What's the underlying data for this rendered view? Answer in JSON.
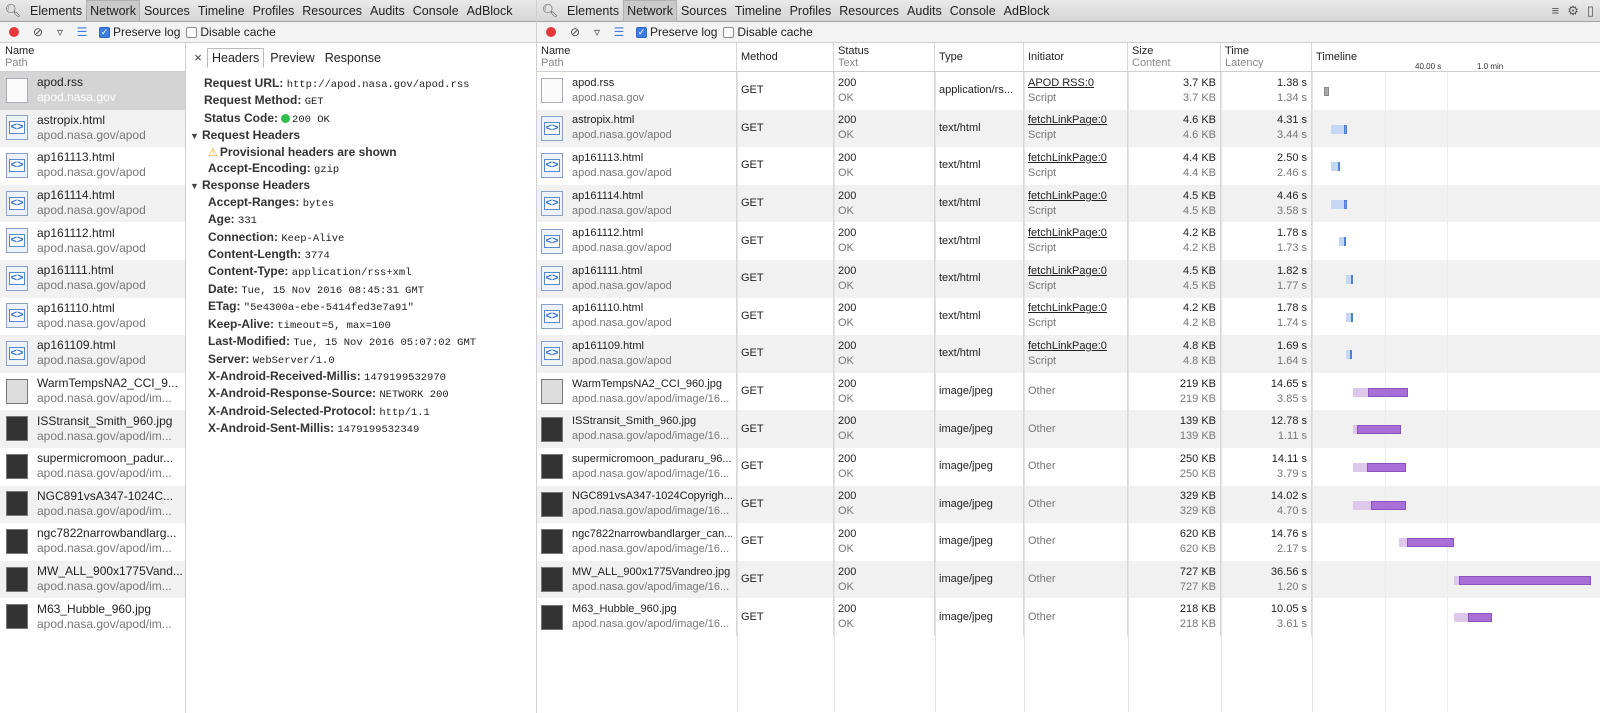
{
  "devtools": {
    "tabs": [
      "Elements",
      "Network",
      "Sources",
      "Timeline",
      "Profiles",
      "Resources",
      "Audits",
      "Console",
      "AdBlock"
    ],
    "selected_tab": "Network",
    "preserve_log": "Preserve log",
    "disable_cache": "Disable cache"
  },
  "left_list": {
    "header_name": "Name",
    "header_path": "Path",
    "items": [
      {
        "name": "apod.rss",
        "path": "apod.nasa.gov",
        "icon": "file-icon"
      },
      {
        "name": "astropix.html",
        "path": "apod.nasa.gov/apod",
        "icon": "html-file-icon"
      },
      {
        "name": "ap161113.html",
        "path": "apod.nasa.gov/apod",
        "icon": "html-file-icon"
      },
      {
        "name": "ap161114.html",
        "path": "apod.nasa.gov/apod",
        "icon": "html-file-icon"
      },
      {
        "name": "ap161112.html",
        "path": "apod.nasa.gov/apod",
        "icon": "html-file-icon"
      },
      {
        "name": "ap161111.html",
        "path": "apod.nasa.gov/apod",
        "icon": "html-file-icon"
      },
      {
        "name": "ap161110.html",
        "path": "apod.nasa.gov/apod",
        "icon": "html-file-icon"
      },
      {
        "name": "ap161109.html",
        "path": "apod.nasa.gov/apod",
        "icon": "html-file-icon"
      },
      {
        "name": "WarmTempsNA2_CCI_9...",
        "path": "apod.nasa.gov/apod/im...",
        "icon": "image-thumbnail-icon"
      },
      {
        "name": "ISStransit_Smith_960.jpg",
        "path": "apod.nasa.gov/apod/im...",
        "icon": "image-thumbnail-icon"
      },
      {
        "name": "supermicromoon_padur...",
        "path": "apod.nasa.gov/apod/im...",
        "icon": "image-thumbnail-icon"
      },
      {
        "name": "NGC891vsA347-1024C...",
        "path": "apod.nasa.gov/apod/im...",
        "icon": "image-thumbnail-icon"
      },
      {
        "name": "ngc7822narrowbandlarg...",
        "path": "apod.nasa.gov/apod/im...",
        "icon": "image-thumbnail-icon"
      },
      {
        "name": "MW_ALL_900x1775Vand...",
        "path": "apod.nasa.gov/apod/im...",
        "icon": "image-thumbnail-icon"
      },
      {
        "name": "M63_Hubble_960.jpg",
        "path": "apod.nasa.gov/apod/im...",
        "icon": "image-thumbnail-icon"
      }
    ]
  },
  "headers_panel": {
    "tabs": [
      "Headers",
      "Preview",
      "Response"
    ],
    "general": [
      {
        "k": "Request URL:",
        "v": "http://apod.nasa.gov/apod.rss"
      },
      {
        "k": "Request Method:",
        "v": "GET"
      }
    ],
    "status_code_label": "Status Code:",
    "status_code_value": "200 OK",
    "request_headers_title": "Request Headers",
    "provisional_notice": "Provisional headers are shown",
    "request_headers": [
      {
        "k": "Accept-Encoding:",
        "v": "gzip"
      }
    ],
    "response_headers_title": "Response Headers",
    "response_headers": [
      {
        "k": "Accept-Ranges:",
        "v": "bytes"
      },
      {
        "k": "Age:",
        "v": "331"
      },
      {
        "k": "Connection:",
        "v": "Keep-Alive"
      },
      {
        "k": "Content-Length:",
        "v": "3774"
      },
      {
        "k": "Content-Type:",
        "v": "application/rss+xml"
      },
      {
        "k": "Date:",
        "v": "Tue, 15 Nov 2016 08:45:31 GMT"
      },
      {
        "k": "ETag:",
        "v": "\"5e4300a-ebe-5414fed3e7a91\""
      },
      {
        "k": "Keep-Alive:",
        "v": "timeout=5, max=100"
      },
      {
        "k": "Last-Modified:",
        "v": "Tue, 15 Nov 2016 05:07:02 GMT"
      },
      {
        "k": "Server:",
        "v": "WebServer/1.0"
      },
      {
        "k": "X-Android-Received-Millis:",
        "v": "1479199532970"
      },
      {
        "k": "X-Android-Response-Source:",
        "v": "NETWORK 200"
      },
      {
        "k": "X-Android-Selected-Protocol:",
        "v": "http/1.1"
      },
      {
        "k": "X-Android-Sent-Millis:",
        "v": "1479199532349"
      }
    ]
  },
  "grid": {
    "columns": {
      "name": "Name",
      "path": "Path",
      "method": "Method",
      "status": "Status",
      "text": "Text",
      "type": "Type",
      "initiator": "Initiator",
      "size": "Size",
      "content": "Content",
      "time": "Time",
      "latency": "Latency",
      "timeline": "Timeline"
    },
    "timeline_marks": [
      "40.00 s",
      "1.0 min"
    ],
    "rows": [
      {
        "name": "apod.rss",
        "path": "apod.nasa.gov",
        "method": "GET",
        "status": "200",
        "text": "OK",
        "type": "application/rs...",
        "init": "APOD RSS:0",
        "init2": "Script",
        "size": "3.7 KB",
        "content": "3.7 KB",
        "time": "1.38 s",
        "latency": "1.34 s",
        "kind": "rss",
        "start": 0.5,
        "wait": 1.34,
        "total": 1.38
      },
      {
        "name": "astropix.html",
        "path": "apod.nasa.gov/apod",
        "method": "GET",
        "status": "200",
        "text": "OK",
        "type": "text/html",
        "init": "fetchLinkPage:0",
        "init2": "Script",
        "size": "4.6 KB",
        "content": "4.6 KB",
        "time": "4.31 s",
        "latency": "3.44 s",
        "kind": "doc",
        "start": 2.3,
        "wait": 3.44,
        "total": 4.31
      },
      {
        "name": "ap161113.html",
        "path": "apod.nasa.gov/apod",
        "method": "GET",
        "status": "200",
        "text": "OK",
        "type": "text/html",
        "init": "fetchLinkPage:0",
        "init2": "Script",
        "size": "4.4 KB",
        "content": "4.4 KB",
        "time": "2.50 s",
        "latency": "2.46 s",
        "kind": "doc",
        "start": 2.3,
        "wait": 2.46,
        "total": 2.5
      },
      {
        "name": "ap161114.html",
        "path": "apod.nasa.gov/apod",
        "method": "GET",
        "status": "200",
        "text": "OK",
        "type": "text/html",
        "init": "fetchLinkPage:0",
        "init2": "Script",
        "size": "4.5 KB",
        "content": "4.5 KB",
        "time": "4.46 s",
        "latency": "3.58 s",
        "kind": "doc",
        "start": 2.3,
        "wait": 3.58,
        "total": 4.46
      },
      {
        "name": "ap161112.html",
        "path": "apod.nasa.gov/apod",
        "method": "GET",
        "status": "200",
        "text": "OK",
        "type": "text/html",
        "init": "fetchLinkPage:0",
        "init2": "Script",
        "size": "4.2 KB",
        "content": "4.2 KB",
        "time": "1.78 s",
        "latency": "1.73 s",
        "kind": "doc",
        "start": 4.6,
        "wait": 1.73,
        "total": 1.78
      },
      {
        "name": "ap161111.html",
        "path": "apod.nasa.gov/apod",
        "method": "GET",
        "status": "200",
        "text": "OK",
        "type": "text/html",
        "init": "fetchLinkPage:0",
        "init2": "Script",
        "size": "4.5 KB",
        "content": "4.5 KB",
        "time": "1.82 s",
        "latency": "1.77 s",
        "kind": "doc",
        "start": 6.4,
        "wait": 1.77,
        "total": 1.82
      },
      {
        "name": "ap161110.html",
        "path": "apod.nasa.gov/apod",
        "method": "GET",
        "status": "200",
        "text": "OK",
        "type": "text/html",
        "init": "fetchLinkPage:0",
        "init2": "Script",
        "size": "4.2 KB",
        "content": "4.2 KB",
        "time": "1.78 s",
        "latency": "1.74 s",
        "kind": "doc",
        "start": 6.4,
        "wait": 1.74,
        "total": 1.78
      },
      {
        "name": "ap161109.html",
        "path": "apod.nasa.gov/apod",
        "method": "GET",
        "status": "200",
        "text": "OK",
        "type": "text/html",
        "init": "fetchLinkPage:0",
        "init2": "Script",
        "size": "4.8 KB",
        "content": "4.8 KB",
        "time": "1.69 s",
        "latency": "1.64 s",
        "kind": "doc",
        "start": 6.4,
        "wait": 1.64,
        "total": 1.69
      },
      {
        "name": "WarmTempsNA2_CCI_960.jpg",
        "path": "apod.nasa.gov/apod/image/16...",
        "method": "GET",
        "status": "200",
        "text": "OK",
        "type": "image/jpeg",
        "init": "Other",
        "init2": "",
        "size": "219 KB",
        "content": "219 KB",
        "time": "14.65 s",
        "latency": "3.85 s",
        "kind": "img",
        "start": 8.3,
        "wait": 3.85,
        "total": 14.65
      },
      {
        "name": "ISStransit_Smith_960.jpg",
        "path": "apod.nasa.gov/apod/image/16...",
        "method": "GET",
        "status": "200",
        "text": "OK",
        "type": "image/jpeg",
        "init": "Other",
        "init2": "",
        "size": "139 KB",
        "content": "139 KB",
        "time": "12.78 s",
        "latency": "1.11 s",
        "kind": "img",
        "start": 8.3,
        "wait": 1.11,
        "total": 12.78
      },
      {
        "name": "supermicromoon_paduraru_96...",
        "path": "apod.nasa.gov/apod/image/16...",
        "method": "GET",
        "status": "200",
        "text": "OK",
        "type": "image/jpeg",
        "init": "Other",
        "init2": "",
        "size": "250 KB",
        "content": "250 KB",
        "time": "14.11 s",
        "latency": "3.79 s",
        "kind": "img",
        "start": 8.3,
        "wait": 3.79,
        "total": 14.11
      },
      {
        "name": "NGC891vsA347-1024Copyrigh...",
        "path": "apod.nasa.gov/apod/image/16...",
        "method": "GET",
        "status": "200",
        "text": "OK",
        "type": "image/jpeg",
        "init": "Other",
        "init2": "",
        "size": "329 KB",
        "content": "329 KB",
        "time": "14.02 s",
        "latency": "4.70 s",
        "kind": "img",
        "start": 8.3,
        "wait": 4.7,
        "total": 14.02
      },
      {
        "name": "ngc7822narrowbandlarger_can...",
        "path": "apod.nasa.gov/apod/image/16...",
        "method": "GET",
        "status": "200",
        "text": "OK",
        "type": "image/jpeg",
        "init": "Other",
        "init2": "",
        "size": "620 KB",
        "content": "620 KB",
        "time": "14.76 s",
        "latency": "2.17 s",
        "kind": "img",
        "start": 20.5,
        "wait": 2.17,
        "total": 14.76
      },
      {
        "name": "MW_ALL_900x1775Vandreo.jpg",
        "path": "apod.nasa.gov/apod/image/16...",
        "method": "GET",
        "status": "200",
        "text": "OK",
        "type": "image/jpeg",
        "init": "Other",
        "init2": "",
        "size": "727 KB",
        "content": "727 KB",
        "time": "36.56 s",
        "latency": "1.20 s",
        "kind": "img",
        "start": 35.2,
        "wait": 1.2,
        "total": 36.56
      },
      {
        "name": "M63_Hubble_960.jpg",
        "path": "apod.nasa.gov/apod/image/16...",
        "method": "GET",
        "status": "200",
        "text": "OK",
        "type": "image/jpeg",
        "init": "Other",
        "init2": "",
        "size": "218 KB",
        "content": "218 KB",
        "time": "10.05 s",
        "latency": "3.61 s",
        "kind": "img",
        "start": 35.2,
        "wait": 3.61,
        "total": 10.05
      }
    ]
  }
}
